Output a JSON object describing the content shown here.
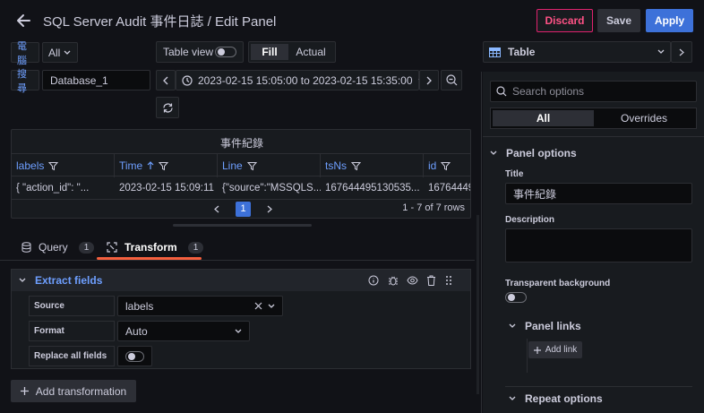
{
  "header": {
    "title": "SQL Server Audit 事件日誌 / Edit Panel",
    "discard_label": "Discard",
    "save_label": "Save",
    "apply_label": "Apply"
  },
  "variables": {
    "computer_label": "電腦",
    "computer_value": "All",
    "search_label": "搜尋",
    "search_value": "Database_1"
  },
  "view_controls": {
    "table_view_label": "Table view",
    "fill_label": "Fill",
    "actual_label": "Actual"
  },
  "time_range": {
    "value": "2023-02-15 15:05:00 to 2023-02-15 15:35:00"
  },
  "table": {
    "title": "事件紀錄",
    "columns": [
      "labels",
      "Time",
      "Line",
      "tsNs",
      "id"
    ],
    "row": [
      "{ \"action_id\": \"...",
      "2023-02-15 15:09:11",
      "{\"source\":\"MSSQLS...",
      "167644495130535...",
      "16764449"
    ],
    "current_page": "1",
    "row_count": "1 - 7 of 7 rows"
  },
  "tabs": {
    "query_label": "Query",
    "query_count": "1",
    "transform_label": "Transform",
    "transform_count": "1"
  },
  "transform": {
    "name": "Extract fields",
    "source_label": "Source",
    "source_value": "labels",
    "format_label": "Format",
    "format_value": "Auto",
    "replace_label": "Replace all fields",
    "add_label": "Add transformation"
  },
  "right_panel": {
    "visualization": "Table",
    "search_placeholder": "Search options",
    "all_label": "All",
    "overrides_label": "Overrides",
    "panel_options_label": "Panel options",
    "title_label": "Title",
    "title_value": "事件紀錄",
    "description_label": "Description",
    "transparent_label": "Transparent background",
    "panel_links_label": "Panel links",
    "add_link_label": "Add link",
    "repeat_options_label": "Repeat options"
  },
  "colors": {
    "accent": "#3d71d9",
    "discard": "#e0226e",
    "link": "#6e9fff",
    "underline": "#f55f3e"
  }
}
